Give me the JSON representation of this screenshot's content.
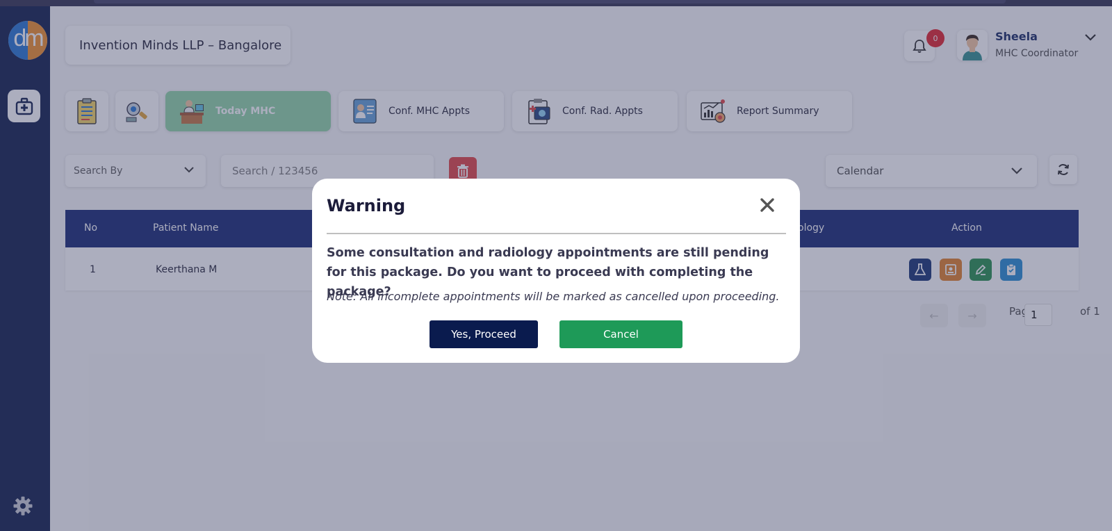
{
  "app": {
    "logo_text": "dm",
    "org_name": "Invention Minds LLP – Bangalore"
  },
  "header": {
    "notification_count": "0",
    "user": {
      "name": "Sheela",
      "role": "MHC Coordinator"
    }
  },
  "tabs": [
    {
      "label": "",
      "icon": "clipboard-icon"
    },
    {
      "label": "",
      "icon": "radiology-icon"
    },
    {
      "label": "Today MHC",
      "icon": "doctor-desk-icon",
      "active": true
    },
    {
      "label": "Conf. MHC Appts",
      "icon": "appointment-icon"
    },
    {
      "label": "Conf. Rad. Appts",
      "icon": "radiology-report-icon"
    },
    {
      "label": "Report Summary",
      "icon": "report-summary-icon"
    }
  ],
  "filters": {
    "search_by": "Search By",
    "search_placeholder": "Search / 123456",
    "calendar": "Calendar"
  },
  "table": {
    "headers": {
      "no": "No",
      "patient_name": "Patient Name",
      "radiology_partial": "ology",
      "action": "Action"
    },
    "rows": [
      {
        "no": "1",
        "patient_name": "Keerthana M"
      }
    ],
    "action_colors": [
      "#0d2a6e",
      "#e07a1f",
      "#1e8a45",
      "#1e88d0"
    ]
  },
  "pagination": {
    "prev": "←",
    "next": "→",
    "page_label": "Page",
    "page_value": "1",
    "of_label": "of 1"
  },
  "modal": {
    "title": "Warning",
    "message": "Some consultation and radiology appointments are still pending for this package. Do you want to proceed with completing the package?",
    "note": "Note: All incomplete appointments will be marked as cancelled upon proceeding.",
    "confirm_label": "Yes, Proceed",
    "cancel_label": "Cancel"
  },
  "colors": {
    "sidebar": "#071544",
    "table_header": "#0d1f6e",
    "active_tab": "#8cd3a3",
    "confirm_button": "#0a1b4e",
    "cancel_button": "#1e9a58"
  }
}
